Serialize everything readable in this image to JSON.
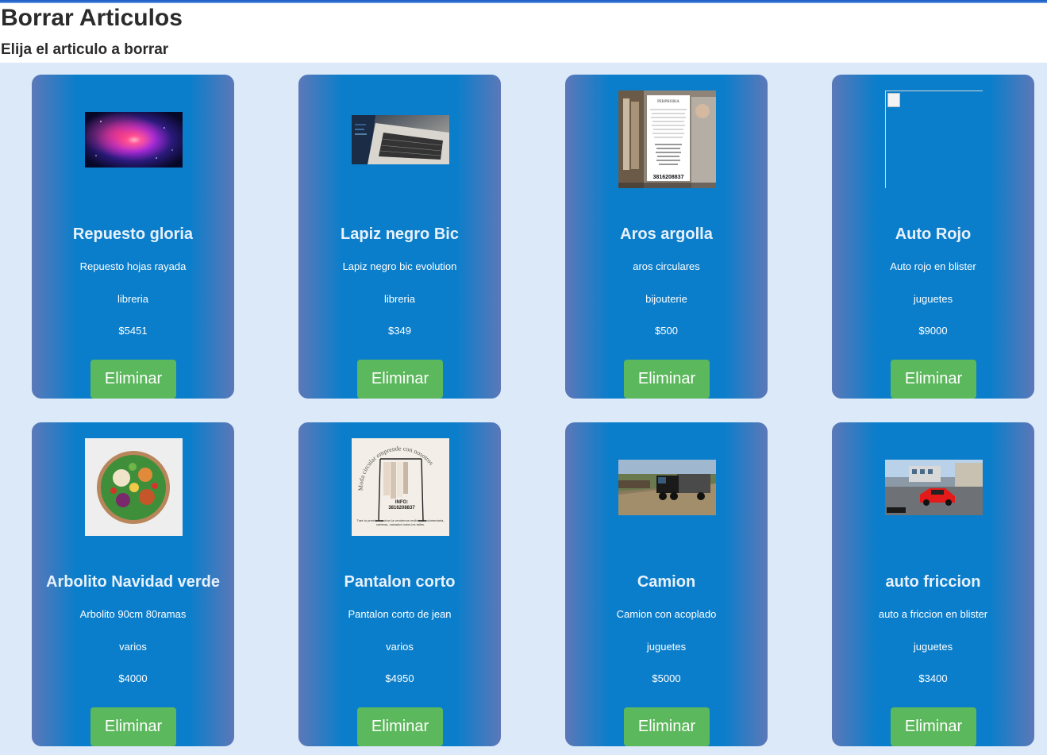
{
  "page": {
    "title": "Borrar Articulos",
    "subtitle": "Elija el articulo a borrar"
  },
  "products": [
    {
      "name": "Repuesto gloria",
      "description": "Repuesto hojas rayada",
      "category": "libreria",
      "price": "$5451",
      "button": "Eliminar",
      "image": "nebula-image"
    },
    {
      "name": "Lapiz negro Bic",
      "description": "Lapiz negro bic evolution",
      "category": "libreria",
      "price": "$349",
      "button": "Eliminar",
      "image": "laptop-image"
    },
    {
      "name": "Aros argolla",
      "description": "aros circulares",
      "category": "bijouterie",
      "price": "$500",
      "button": "Eliminar",
      "image": "flyer-image",
      "image_text": {
        "brand": "PERPHORIA",
        "phone": "3816208837"
      }
    },
    {
      "name": "Auto Rojo",
      "description": "Auto rojo en blister",
      "category": "juguetes",
      "price": "$9000",
      "button": "Eliminar",
      "image": "broken-image"
    },
    {
      "name": "Arbolito Navidad verde",
      "description": "Arbolito 90cm 80ramas",
      "category": "varios",
      "price": "$4000",
      "button": "Eliminar",
      "image": "salad-bowl-image"
    },
    {
      "name": "Pantalon corto",
      "description": "Pantalon corto de jean",
      "category": "varios",
      "price": "$4950",
      "button": "Eliminar",
      "image": "clothes-rack-flyer-image",
      "image_text": {
        "arc": "Moda circular emprende con nosotros",
        "info": "INFO:",
        "phone": "3816208837",
        "footer": "Trae tu prenda nosotros la vendemos recibimos indumentaria, carteras, calzados todos los talles."
      }
    },
    {
      "name": "Camion",
      "description": "Camion con acoplado",
      "category": "juguetes",
      "price": "$5000",
      "button": "Eliminar",
      "image": "truck-image"
    },
    {
      "name": "auto friccion",
      "description": "auto a friccion en blister",
      "category": "juguetes",
      "price": "$3400",
      "button": "Eliminar",
      "image": "red-car-image"
    }
  ],
  "colors": {
    "card_center": "#0a7ecb",
    "card_edge": "#5c78b8",
    "button": "#5cb85c",
    "background": "#dbe9f8",
    "top_bar": "#1f5fc4"
  }
}
